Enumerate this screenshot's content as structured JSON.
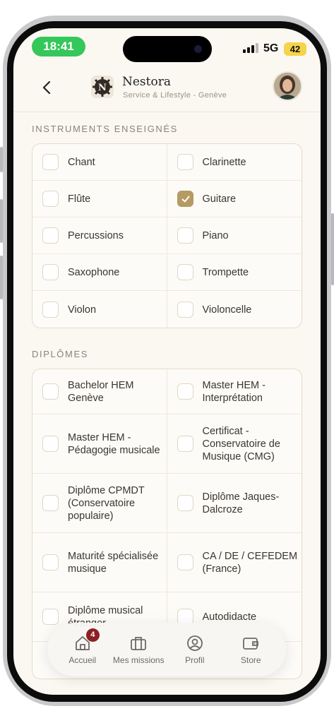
{
  "status_bar": {
    "time": "18:41",
    "network": "5G",
    "battery": "42"
  },
  "header": {
    "brand_name": "Nestora",
    "brand_subtitle": "Service & Lifestyle - Genève"
  },
  "instruments": {
    "title": "INSTRUMENTS ENSEIGNÉS",
    "items": [
      {
        "label": "Chant",
        "checked": false
      },
      {
        "label": "Clarinette",
        "checked": false
      },
      {
        "label": "Flûte",
        "checked": false
      },
      {
        "label": "Guitare",
        "checked": true
      },
      {
        "label": "Percussions",
        "checked": false
      },
      {
        "label": "Piano",
        "checked": false
      },
      {
        "label": "Saxophone",
        "checked": false
      },
      {
        "label": "Trompette",
        "checked": false
      },
      {
        "label": "Violon",
        "checked": false
      },
      {
        "label": "Violoncelle",
        "checked": false
      }
    ]
  },
  "diplomes": {
    "title": "DIPLÔMES",
    "items": [
      {
        "label": "Bachelor HEM Genève",
        "checked": false
      },
      {
        "label": "Master HEM - Interprétation",
        "checked": false
      },
      {
        "label": "Master HEM - Pédagogie musicale",
        "checked": false
      },
      {
        "label": "Certificat - Conservatoire de Musique (CMG)",
        "checked": false
      },
      {
        "label": "Diplôme CPMDT (Conservatoire populaire)",
        "checked": false
      },
      {
        "label": "Diplôme Jaques-Dalcroze",
        "checked": false
      },
      {
        "label": "Maturité spécialisée musique",
        "checked": false
      },
      {
        "label": "CA / DE / CEFEDEM (France)",
        "checked": false
      },
      {
        "label": "Diplôme musical étranger",
        "checked": false
      },
      {
        "label": "Autodidacte",
        "checked": false
      }
    ]
  },
  "tabbar": {
    "tabs": [
      {
        "label": "Accueil",
        "icon": "home-icon",
        "badge": "4"
      },
      {
        "label": "Mes missions",
        "icon": "briefcase-icon"
      },
      {
        "label": "Profil",
        "icon": "user-icon"
      },
      {
        "label": "Store",
        "icon": "wallet-icon"
      }
    ]
  },
  "colors": {
    "accent": "#b59a64",
    "background": "#fbf8f2",
    "badge": "#8e1f24",
    "status_green": "#34c759"
  }
}
